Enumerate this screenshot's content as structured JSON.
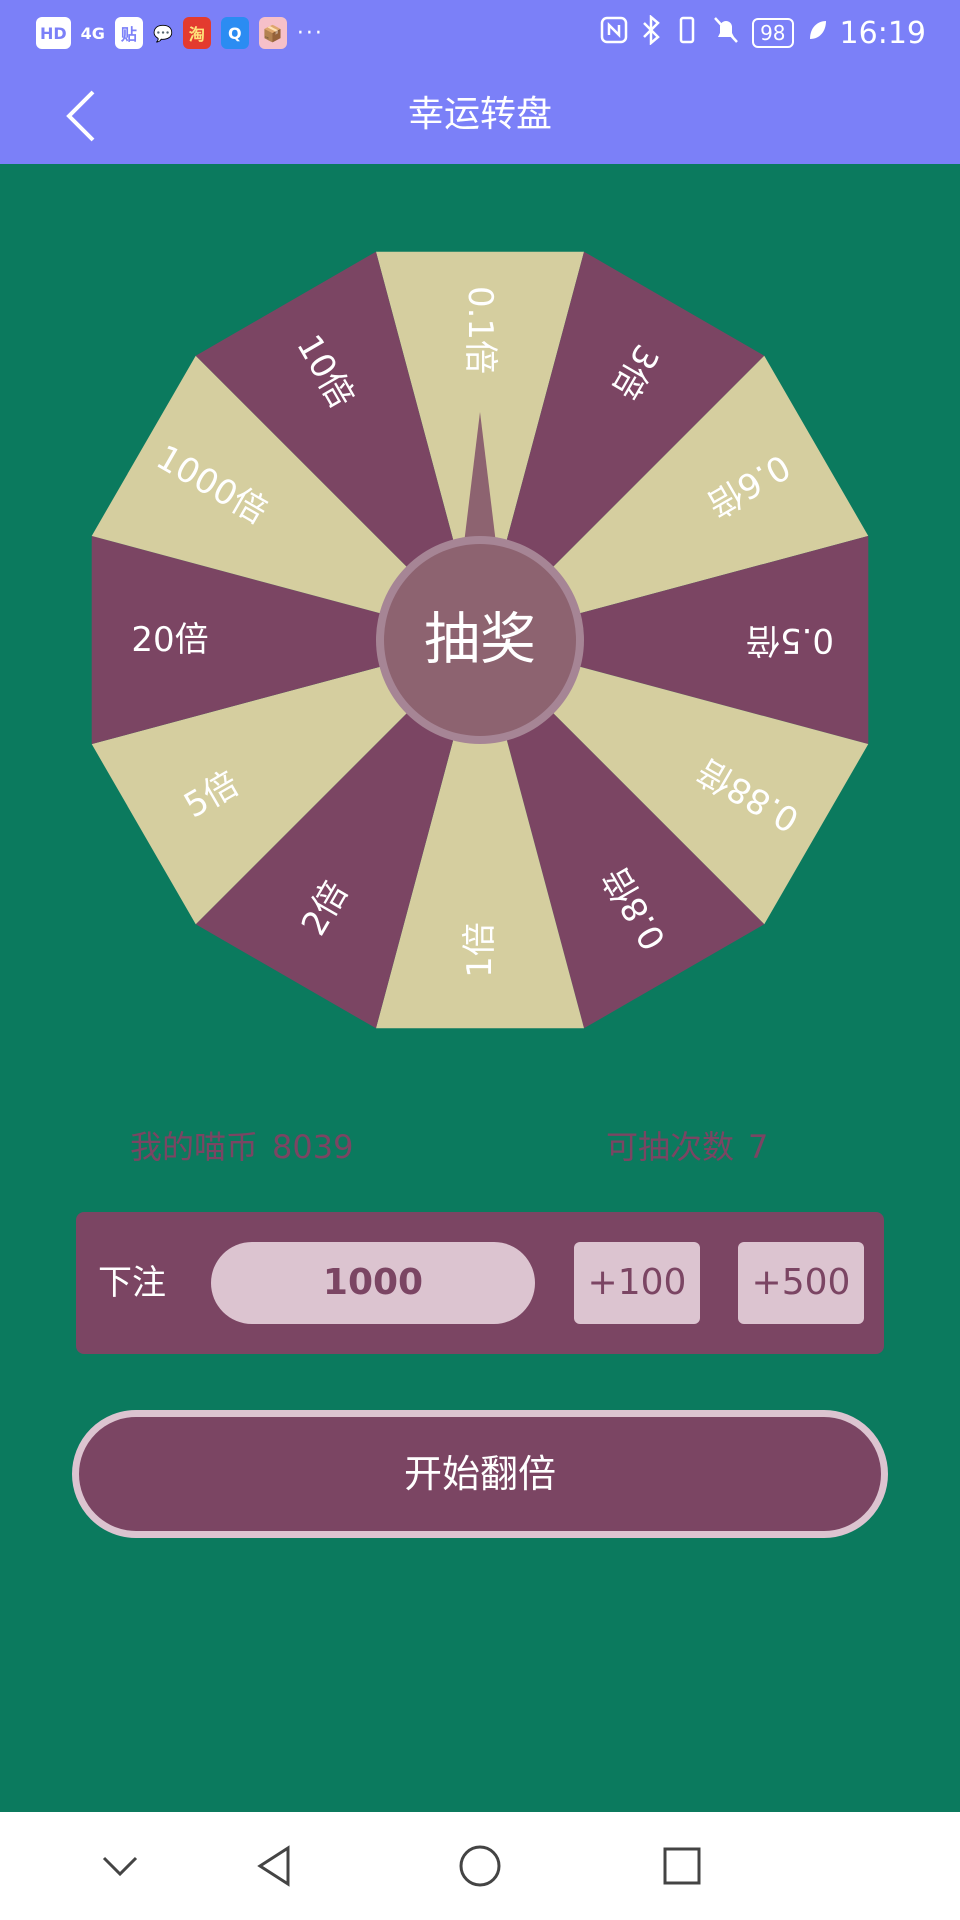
{
  "status_bar": {
    "left_icons": [
      "HD",
      "4G",
      "贴",
      "💬",
      "淘",
      "Q",
      "📦"
    ],
    "more": "···",
    "battery": "98",
    "time": "16:19"
  },
  "header": {
    "title": "幸运转盘"
  },
  "wheel": {
    "segments": [
      "0.1倍",
      "3倍",
      "0.6倍",
      "0.5倍",
      "0.88倍",
      "0.8倍",
      "1倍",
      "2倍",
      "5倍",
      "20倍",
      "1000倍",
      "10倍"
    ],
    "center_label": "抽奖",
    "colors": {
      "light": "#d5ce9f",
      "dark": "#7b4563",
      "center": "#8d6370",
      "center_ring": "#a68595"
    }
  },
  "stats": {
    "coins_label": "我的喵币",
    "coins_value": "8039",
    "draws_label": "可抽次数",
    "draws_value": "7"
  },
  "bet": {
    "label": "下注",
    "value": "1000",
    "add_100": "+100",
    "add_500": "+500"
  },
  "start_button": "开始翻倍",
  "colors": {
    "header": "#7b80f8",
    "background": "#0b7a5e",
    "accent": "#7b4563",
    "accent_light": "#dcc4d0"
  }
}
